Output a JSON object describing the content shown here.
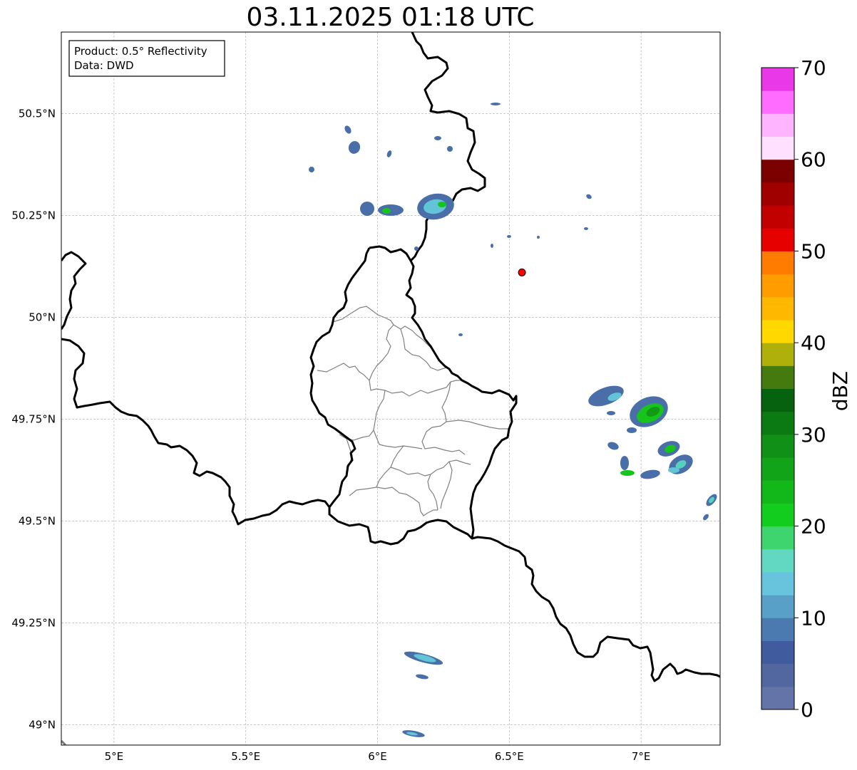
{
  "title": "03.11.2025 01:18 UTC",
  "info_box": {
    "line1": "Product: 0.5° Reflectivity",
    "line2": "Data: DWD"
  },
  "map": {
    "lon_range": [
      4.8,
      7.3
    ],
    "lat_range": [
      48.95,
      50.7
    ],
    "x_ticks": [
      {
        "value": 5.0,
        "label": "5°E"
      },
      {
        "value": 5.5,
        "label": "5.5°E"
      },
      {
        "value": 6.0,
        "label": "6°E"
      },
      {
        "value": 6.5,
        "label": "6.5°E"
      },
      {
        "value": 7.0,
        "label": "7°E"
      }
    ],
    "y_ticks": [
      {
        "value": 49.0,
        "label": "49°N"
      },
      {
        "value": 49.25,
        "label": "49.25°N"
      },
      {
        "value": 49.5,
        "label": "49.5°N"
      },
      {
        "value": 49.75,
        "label": "49.75°N"
      },
      {
        "value": 50.0,
        "label": "50°N"
      },
      {
        "value": 50.25,
        "label": "50.25°N"
      },
      {
        "value": 50.5,
        "label": "50.5°N"
      }
    ],
    "grid": true,
    "radar_site": {
      "lon": 6.548,
      "lat": 50.11,
      "color": "#ff0000"
    }
  },
  "colorbar": {
    "label": "dBZ",
    "min": 0,
    "max": 70,
    "tick_values": [
      0,
      10,
      20,
      30,
      40,
      50,
      60,
      70
    ],
    "tick_labels": [
      "0",
      "10",
      "20",
      "30",
      "40",
      "50",
      "60",
      "70"
    ],
    "colors": [
      "#6473a8",
      "#52679f",
      "#405b9e",
      "#4a7ab0",
      "#58a0c8",
      "#68c4dc",
      "#62d8c2",
      "#3ed56e",
      "#12cc1e",
      "#12b81a",
      "#12a418",
      "#109016",
      "#0c7a12",
      "#076210",
      "#447a0e",
      "#b0b00a",
      "#ffd800",
      "#ffb800",
      "#ff9c00",
      "#ff7c00",
      "#e60000",
      "#c20000",
      "#a00000",
      "#7c0000",
      "#ffe0ff",
      "#ffb4ff",
      "#ff6cff",
      "#e838e8"
    ]
  },
  "echo_colors": {
    "weak": "#4a6ea8",
    "light": "#5a8cc0",
    "cyan": "#62c4d6",
    "teal": "#58d0c0",
    "green": "#16c41c",
    "dark_green": "#129a16"
  }
}
